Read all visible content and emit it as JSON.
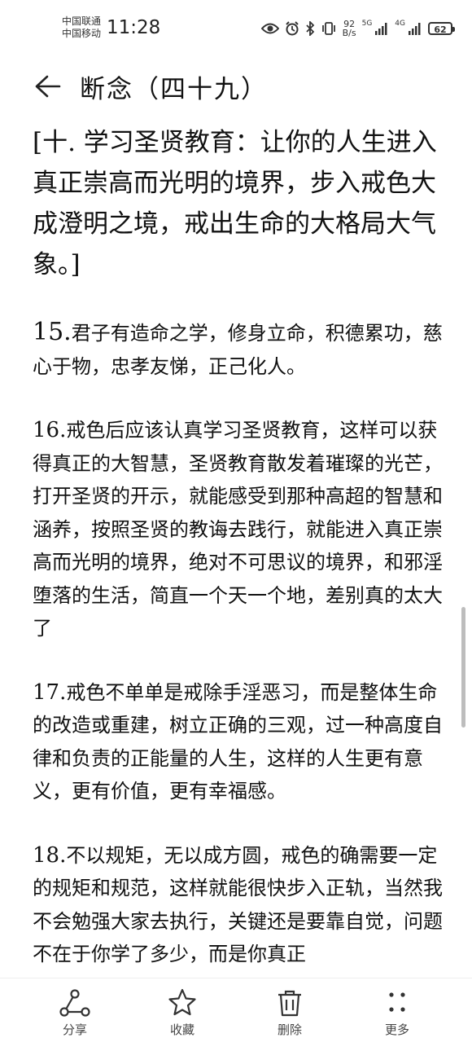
{
  "status_bar": {
    "carrier_1": "中国联通",
    "carrier_2": "中国移动",
    "time": "11:28",
    "net_speed_value": "92",
    "net_speed_unit": "B/s",
    "signal_1_label": "5G",
    "signal_2_label": "4G",
    "battery": "62",
    "icons": [
      "eye-icon",
      "alarm-icon",
      "bluetooth-icon",
      "vibrate-icon",
      "signal-icon",
      "battery-icon"
    ]
  },
  "header": {
    "title": "断念（四十九）"
  },
  "content": {
    "lead": "[十. 学习圣贤教育：让你的人生进入真正崇高而光明的境界，步入戒色大成澄明之境，戒出生命的大格局大气象。]",
    "paragraphs": [
      {
        "num": "15.",
        "text": "君子有造命之学，修身立命，积德累功，慈心于物，忠孝友悌，正己化人。"
      },
      {
        "num": "16.",
        "text": "戒色后应该认真学习圣贤教育，这样可以获得真正的大智慧，圣贤教育散发着璀璨的光芒，打开圣贤的开示，就能感受到那种高超的智慧和涵养，按照圣贤的教诲去践行，就能进入真正崇高而光明的境界，绝对不可思议的境界，和邪淫堕落的生活，简直一个天一个地，差别真的太大了"
      },
      {
        "num": "17.",
        "text": "戒色不单单是戒除手淫恶习，而是整体生命的改造或重建，树立正确的三观，过一种高度自律和负责的正能量的人生，这样的人生更有意义，更有价值，更有幸福感。"
      },
      {
        "num": "18.",
        "text": "不以规矩，无以成方圆，戒色的确需要一定的规矩和规范，这样就能很快步入正轨，当然我不会勉强大家去执行，关键还是要靠自觉，问题不在于你学了多少，而是你真正"
      }
    ]
  },
  "bottom_bar": {
    "share": "分享",
    "favorite": "收藏",
    "delete": "删除",
    "more": "更多"
  }
}
